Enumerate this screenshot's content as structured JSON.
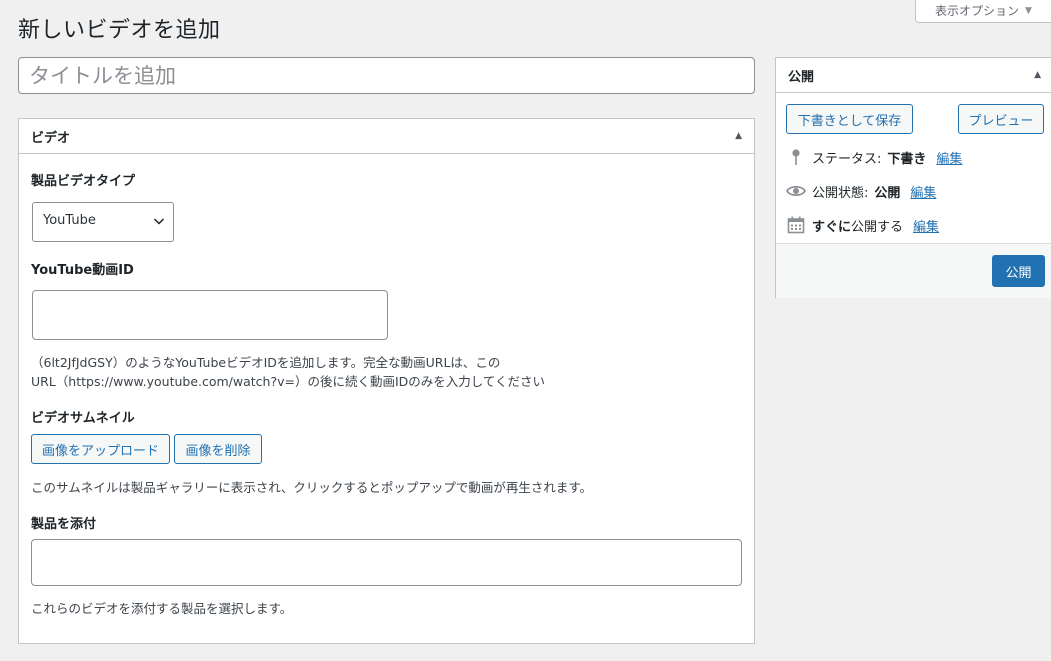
{
  "screen_options": {
    "label": "表示オプション"
  },
  "page_title": "新しいビデオを追加",
  "title_field": {
    "placeholder": "タイトルを追加",
    "value": ""
  },
  "video_box": {
    "title": "ビデオ",
    "type_label": "製品ビデオタイプ",
    "type_selected": "YouTube",
    "id_label": "YouTube動画ID",
    "id_value": "",
    "id_desc_line1": "（6lt2JfJdGSY）のようなYouTubeビデオIDを追加します。完全な動画URLは、この",
    "id_desc_line2": "URL（https://www.youtube.com/watch?v=）の後に続く動画IDのみを入力してください",
    "thumb_label": "ビデオサムネイル",
    "upload_button": "画像をアップロード",
    "remove_button": "画像を削除",
    "thumb_desc": "このサムネイルは製品ギャラリーに表示され、クリックするとポップアップで動画が再生されます。",
    "attach_label": "製品を添付",
    "attach_value": "",
    "attach_desc": "これらのビデオを添付する製品を選択します。"
  },
  "publish_box": {
    "title": "公開",
    "save_draft": "下書きとして保存",
    "preview": "プレビュー",
    "status_label": "ステータス:",
    "status_value": "下書き",
    "visibility_label": "公開状態:",
    "visibility_value": "公開",
    "schedule_bold": "すぐに",
    "schedule_text": "公開する",
    "edit_link": "編集",
    "publish_button": "公開"
  },
  "icons": {
    "status": "pin-icon",
    "visibility": "eye-icon",
    "schedule": "calendar-icon",
    "select": "chevron-down-icon",
    "toggle": "triangle-up-icon"
  },
  "colors": {
    "accent": "#2271b1",
    "background": "#f0f0f1"
  }
}
